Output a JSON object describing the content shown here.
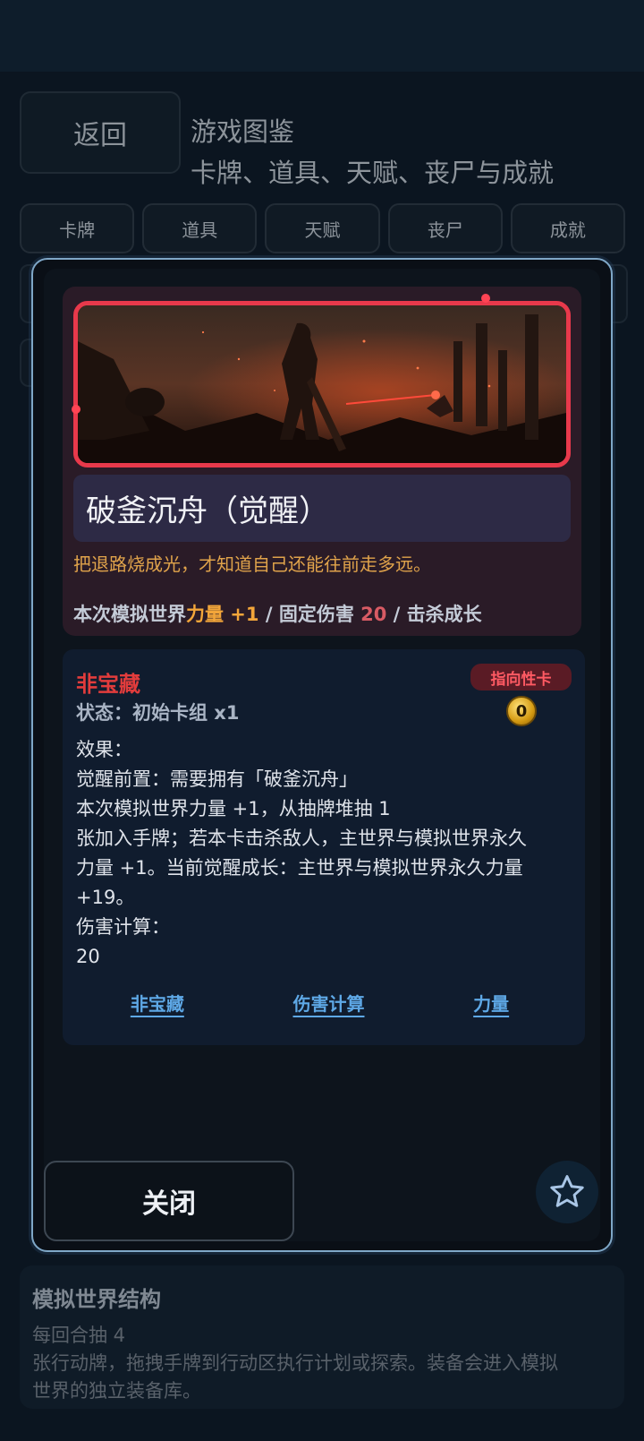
{
  "header": {
    "back_label": "返回",
    "title": "游戏图鉴",
    "subtitle": "卡牌、道具、天赋、丧尸与成就"
  },
  "tabs": [
    {
      "label": "卡牌"
    },
    {
      "label": "道具"
    },
    {
      "label": "天赋"
    },
    {
      "label": "丧尸"
    },
    {
      "label": "成就"
    }
  ],
  "card": {
    "name": "破釜沉舟（觉醒）",
    "flavor": "把退路烧成光，才知道自己还能往前走多远。",
    "stats": {
      "prefix": "本次模拟世界",
      "power": "力量 +1",
      "sep1": " / ",
      "damage_label": "固定伤害 ",
      "damage_value": "20",
      "sep2": " / ",
      "growth": "击杀成长"
    },
    "rarity": "非宝藏",
    "status": "状态：初始卡组 x1",
    "type_badge": "指向性卡",
    "cost": "0",
    "effect_lines": [
      "效果：",
      "觉醒前置：需要拥有「破釜沉舟」",
      "本次模拟世界力量 +1，从抽牌堆抽 1",
      "张加入手牌；若本卡击杀敌人，主世界与模拟世界永久",
      "力量 +1。当前觉醒成长：主世界与模拟世界永久力量",
      "+19。",
      "伤害计算：",
      "20"
    ],
    "keywords": [
      "非宝藏",
      "伤害计算",
      "力量"
    ]
  },
  "modal": {
    "close_label": "关闭",
    "favorite_icon": "star-icon"
  },
  "info": {
    "title": "模拟世界结构",
    "line1": "每回合抽 4",
    "line2": "张行动牌，拖拽手牌到行动区执行计划或探索。装备会进入模拟",
    "line3": "世界的独立装备库。"
  },
  "colors": {
    "accent_red": "#e8394b",
    "flavor_orange": "#e0a34b",
    "keyword_blue": "#5ea8e6",
    "modal_border": "#7fa7c7"
  }
}
